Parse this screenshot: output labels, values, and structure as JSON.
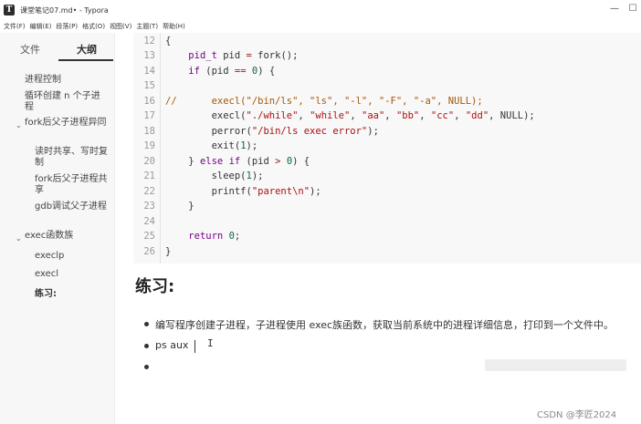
{
  "window": {
    "title": "课堂笔记07.md• - Typora",
    "app_icon_glyph": "T"
  },
  "window_controls": {
    "minimize": "—",
    "maximize": "☐"
  },
  "menu": [
    "文件(F)",
    "编辑(E)",
    "段落(P)",
    "格式(O)",
    "视图(V)",
    "主题(T)",
    "帮助(H)"
  ],
  "sidebar": {
    "tabs": [
      {
        "label": "文件"
      },
      {
        "label": "大纲"
      }
    ],
    "active_tab": "大纲",
    "outline": [
      {
        "label": "进程控制",
        "level": 1
      },
      {
        "label": "循环创建 n 个子进程",
        "level": 1
      },
      {
        "label": "fork后父子进程异同",
        "level": 1,
        "expanded": true
      },
      {
        "label": "读时共享、写时复制",
        "level": 2
      },
      {
        "label": "fork后父子进程共享",
        "level": 2
      },
      {
        "label": "gdb调试父子进程",
        "level": 2
      },
      {
        "label": "exec函数族",
        "level": 1,
        "expanded": true
      },
      {
        "label": "execlp",
        "level": 2
      },
      {
        "label": "execl",
        "level": 2
      },
      {
        "label": "练习:",
        "level": 2,
        "active": true
      }
    ]
  },
  "code": {
    "lines": [
      {
        "n": "12",
        "text": "{"
      },
      {
        "n": "13",
        "text": "    pid_t pid = fork();"
      },
      {
        "n": "14",
        "text": "    if (pid == 0) {"
      },
      {
        "n": "15",
        "text": ""
      },
      {
        "n": "16",
        "text": "//      execl(\"/bin/ls\", \"ls\", \"-l\", \"-F\", \"-a\", NULL);"
      },
      {
        "n": "17",
        "text": "        execl(\"./while\", \"while\", \"aa\", \"bb\", \"cc\", \"dd\", NULL);"
      },
      {
        "n": "18",
        "text": "        perror(\"/bin/ls exec error\");"
      },
      {
        "n": "19",
        "text": "        exit(1);"
      },
      {
        "n": "20",
        "text": "    } else if (pid > 0) {"
      },
      {
        "n": "21",
        "text": "        sleep(1);"
      },
      {
        "n": "22",
        "text": "        printf(\"parent\\n\");"
      },
      {
        "n": "23",
        "text": "    }"
      },
      {
        "n": "24",
        "text": ""
      },
      {
        "n": "25",
        "text": "    return 0;"
      },
      {
        "n": "26",
        "text": "}"
      }
    ]
  },
  "doc": {
    "heading": "练习:",
    "list": [
      "编写程序创建子进程，子进程使用 exec族函数，获取当前系统中的进程详细信息，打印到一个文件中。",
      "ps aux",
      ""
    ]
  },
  "watermark": "CSDN @李匠2024",
  "colors": {
    "sidebar_bg": "#f7f7f7",
    "code_bg": "#f8f8f8",
    "keyword": "#770088",
    "string": "#aa1111",
    "number": "#116644",
    "comment": "#aa5500"
  }
}
